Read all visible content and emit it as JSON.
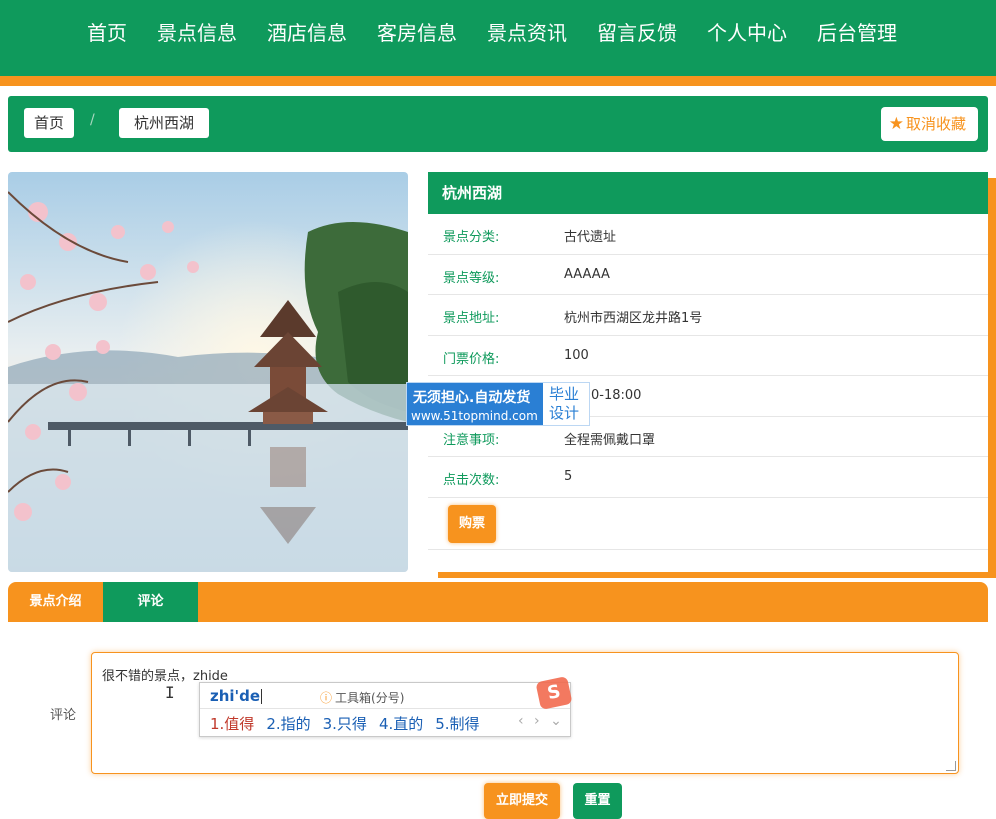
{
  "nav": {
    "items": [
      "首页",
      "景点信息",
      "酒店信息",
      "客房信息",
      "景点资讯",
      "留言反馈",
      "个人中心",
      "后台管理"
    ]
  },
  "breadcrumb": {
    "home": "首页",
    "separator": "/",
    "current": "杭州西湖"
  },
  "favorite": {
    "label": "取消收藏",
    "icon": "star-icon"
  },
  "photo": {
    "description_icon": "west-lake-pavilion-photo"
  },
  "info": {
    "title": "杭州西湖",
    "rows": [
      {
        "label": "景点分类:",
        "value": "古代遗址"
      },
      {
        "label": "景点等级:",
        "value": "AAAAA"
      },
      {
        "label": "景点地址:",
        "value": "杭州市西湖区龙井路1号"
      },
      {
        "label": "门票价格:",
        "value": "100"
      },
      {
        "label": "",
        "value": "0-18:00"
      },
      {
        "label": "注意事项:",
        "value": "全程需佩戴口罩"
      },
      {
        "label": "点击次数:",
        "value": "5"
      }
    ],
    "buy_label": "购票"
  },
  "watermark": {
    "line1": "无须担心.自动发货",
    "line2": "www.51topmind.com",
    "side1": "毕业",
    "side2": "设计"
  },
  "tabs": {
    "intro": "景点介绍",
    "comment": "评论"
  },
  "comment": {
    "label": "评论",
    "text": "很不错的景点，zhide"
  },
  "ime": {
    "pinyin": "zhi'de",
    "toolbox": "工具箱(分号)",
    "logo": "S",
    "candidates": [
      "1.值得",
      "2.指的",
      "3.只得",
      "4.直的",
      "5.制得"
    ],
    "nav": "‹ › ⌄"
  },
  "buttons": {
    "submit": "立即提交",
    "reset": "重置"
  },
  "colors": {
    "green": "#0f9a5c",
    "orange": "#f7931e",
    "ime_blue": "#1a5fb4"
  }
}
